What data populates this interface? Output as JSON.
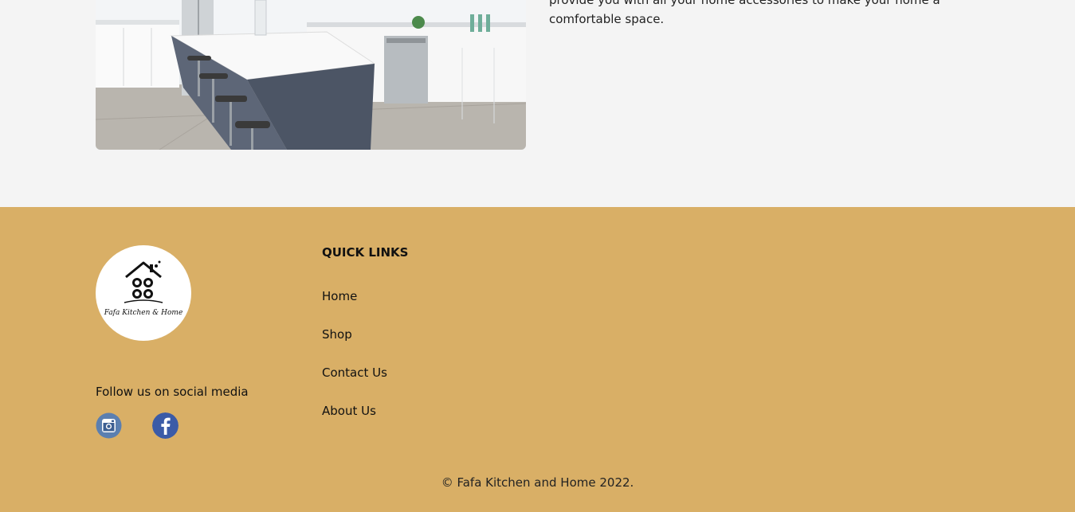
{
  "about": {
    "text_line1": "provide you with all your home accessories to make your home a",
    "text_line2": "comfortable space.",
    "image_alt": "kitchen-photo"
  },
  "footer": {
    "logo_text": "Fafa Kitchen & Home",
    "follow_label": "Follow us on social media",
    "social": {
      "instagram_icon": "instagram-icon",
      "facebook_icon": "facebook-icon"
    },
    "quick_links_title": "QUICK LINKS",
    "quick_links": [
      {
        "label": "Home"
      },
      {
        "label": "Shop"
      },
      {
        "label": "Contact Us"
      },
      {
        "label": "About Us"
      }
    ],
    "copyright": "© Fafa Kitchen and Home 2022."
  },
  "colors": {
    "footer_bg": "#d9af66",
    "page_bg": "#f4f4f4",
    "social_icon_blue": "#4a6fa5"
  }
}
